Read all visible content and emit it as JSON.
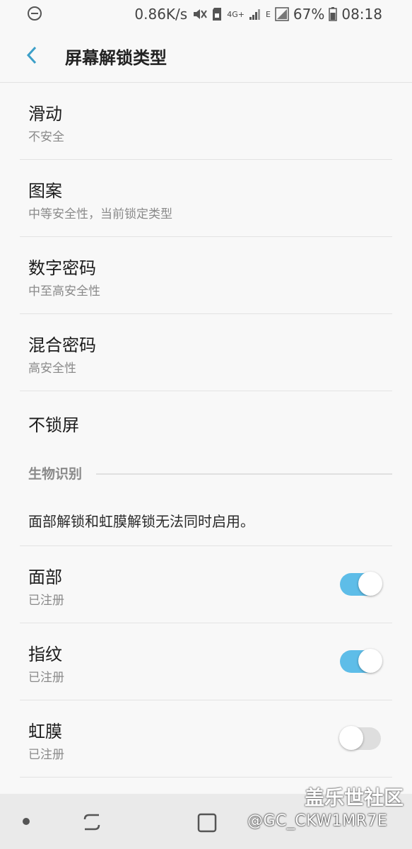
{
  "status": {
    "speed": "0.86K/s",
    "network": "4G+",
    "signal2": "E",
    "battery": "67%",
    "time": "08:18"
  },
  "header": {
    "title": "屏幕解锁类型"
  },
  "lock_types": [
    {
      "title": "滑动",
      "subtitle": "不安全"
    },
    {
      "title": "图案",
      "subtitle": "中等安全性，当前锁定类型"
    },
    {
      "title": "数字密码",
      "subtitle": "中至高安全性"
    },
    {
      "title": "混合密码",
      "subtitle": "高安全性"
    },
    {
      "title": "不锁屏"
    }
  ],
  "biometrics": {
    "section_label": "生物识别",
    "note": "面部解锁和虹膜解锁无法同时启用。",
    "items": [
      {
        "title": "面部",
        "subtitle": "已注册",
        "enabled": true
      },
      {
        "title": "指纹",
        "subtitle": "已注册",
        "enabled": true
      },
      {
        "title": "虹膜",
        "subtitle": "已注册",
        "enabled": false
      }
    ]
  },
  "watermark": {
    "site": "盖乐世社区",
    "user": "@GC_CKW1MR7E"
  },
  "colors": {
    "accent": "#5ebde8",
    "back_arrow": "#3c9fc8"
  }
}
